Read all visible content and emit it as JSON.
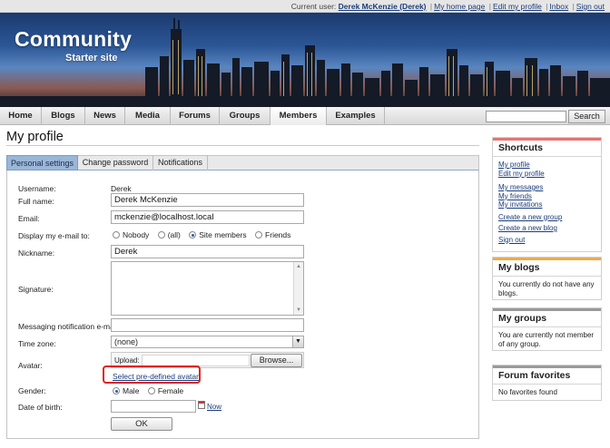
{
  "topbar": {
    "current_user_label": "Current user:",
    "current_user": "Derek McKenzie (Derek)",
    "links": [
      "My home page",
      "Edit my profile",
      "Inbox",
      "Sign out"
    ]
  },
  "logo": {
    "title": "Community",
    "subtitle": "Starter site"
  },
  "nav": {
    "items": [
      "Home",
      "Blogs",
      "News",
      "Media",
      "Forums",
      "Groups",
      "Members",
      "Examples"
    ],
    "active": "Members",
    "search_button": "Search"
  },
  "page": {
    "title": "My profile"
  },
  "tabs": [
    "Personal settings",
    "Change password",
    "Notifications"
  ],
  "form": {
    "username_label": "Username:",
    "username_value": "Derek",
    "fullname_label": "Full name:",
    "fullname_value": "Derek McKenzie",
    "email_label": "Email:",
    "email_value": "mckenzie@localhost.local",
    "display_email_label": "Display my e-mail to:",
    "display_email_options": [
      "Nobody",
      "(all)",
      "Site members",
      "Friends"
    ],
    "display_email_selected": "Site members",
    "nickname_label": "Nickname:",
    "nickname_value": "Derek",
    "signature_label": "Signature:",
    "messaging_label": "Messaging notification e-mail:",
    "timezone_label": "Time zone:",
    "timezone_value": "(none)",
    "avatar_label": "Avatar:",
    "upload_label": "Upload:",
    "browse_button": "Browse...",
    "predefined_avatar_link": "Select pre-defined avatar",
    "gender_label": "Gender:",
    "gender_options": [
      "Male",
      "Female"
    ],
    "gender_selected": "Male",
    "dob_label": "Date of birth:",
    "now_link": "Now",
    "ok_button": "OK"
  },
  "sidebar": {
    "shortcuts": {
      "title": "Shortcuts",
      "group1": [
        "My profile",
        "Edit my profile"
      ],
      "group2": [
        "My messages",
        "My friends",
        "My invitations"
      ],
      "group3": [
        "Create a new group",
        "Create a new blog",
        "Sign out"
      ]
    },
    "blogs": {
      "title": "My blogs",
      "text": "You currently do not have any blogs."
    },
    "groups": {
      "title": "My groups",
      "text": "You are currently not member of any group."
    },
    "forum": {
      "title": "Forum favorites",
      "text": "No favorites found"
    }
  },
  "colors": {
    "shortcuts_strip": "#e57373",
    "blogs_strip": "#f0a94a",
    "groups_strip": "#9a9a9a",
    "forum_strip": "#9a9a9a",
    "link": "#1a3c7a",
    "highlight": "#e02020"
  }
}
